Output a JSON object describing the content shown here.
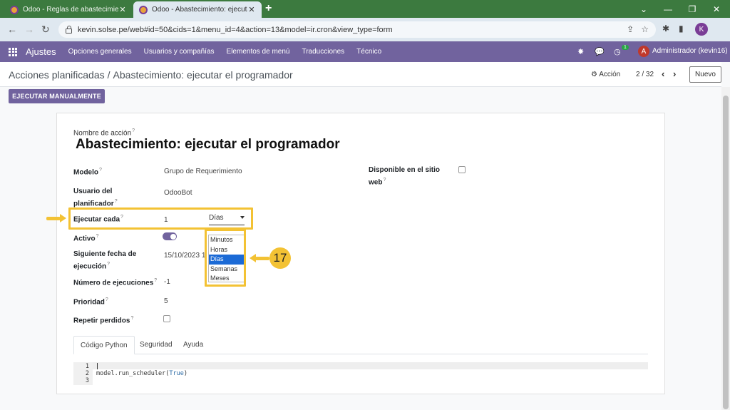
{
  "browser": {
    "tabs": [
      {
        "title": "Odoo - Reglas de abastecimient",
        "active": false
      },
      {
        "title": "Odoo - Abastecimiento: ejecuta",
        "active": true
      }
    ],
    "url": "kevin.solse.pe/web#id=50&cids=1&menu_id=4&action=13&model=ir.cron&view_type=form",
    "profile_initial": "K",
    "icons": {
      "new_tab": "+",
      "back": "←",
      "forward": "→",
      "reload": "↻",
      "minimize": "⌄",
      "min": "—",
      "restore": "❐",
      "close": "✕"
    }
  },
  "navbar": {
    "app_name": "Ajustes",
    "menu": [
      "Opciones generales",
      "Usuarios y compañías",
      "Elementos de menú",
      "Traducciones",
      "Técnico"
    ],
    "activity_count": "1",
    "user_initial": "A",
    "user_name": "Administrador (kevin16)"
  },
  "control_panel": {
    "breadcrumb_parent": "Acciones planificadas",
    "breadcrumb_sep": "/",
    "breadcrumb_current": "Abastecimiento: ejecutar el programador",
    "action_label": "Acción",
    "pager": "2 / 32",
    "new_button": "Nuevo"
  },
  "form": {
    "run_button": "EJECUTAR MANUALMENTE",
    "name_label": "Nombre de acción",
    "name_value": "Abastecimiento: ejecutar el programador",
    "help_mark": "?",
    "fields": {
      "modelo_label": "Modelo",
      "modelo_value": "Grupo de Requerimiento",
      "usuario_label_1": "Usuario del",
      "usuario_label_2": "planificador",
      "usuario_value": "OdooBot",
      "ejecutar_label": "Ejecutar cada",
      "interval_number": "1",
      "interval_type": "Días",
      "activo_label": "Activo",
      "siguiente_label_1": "Siguiente fecha de",
      "siguiente_label_2": "ejecución",
      "siguiente_value": "15/10/2023 1",
      "numero_label": "Número de ejecuciones",
      "numero_value": "-1",
      "prioridad_label": "Prioridad",
      "prioridad_value": "5",
      "repetir_label": "Repetir perdidos",
      "disponible_label_1": "Disponible en el sitio",
      "disponible_label_2": "web"
    },
    "interval_options": [
      "Minutos",
      "Horas",
      "Días",
      "Semanas",
      "Meses"
    ],
    "selected_option": "Días",
    "step_number": "17",
    "notebook_tabs": [
      "Código Python",
      "Seguridad",
      "Ayuda"
    ],
    "code": {
      "line_numbers": [
        "1",
        "2",
        "3"
      ],
      "line2_prefix": "model.run_scheduler(",
      "line2_kw": "True",
      "line2_suffix": ")"
    }
  },
  "colors": {
    "odoo_primary": "#71639e",
    "highlight": "#f3c234",
    "browser_frame": "#3c7a3f",
    "selected_option": "#1b6ad6"
  }
}
